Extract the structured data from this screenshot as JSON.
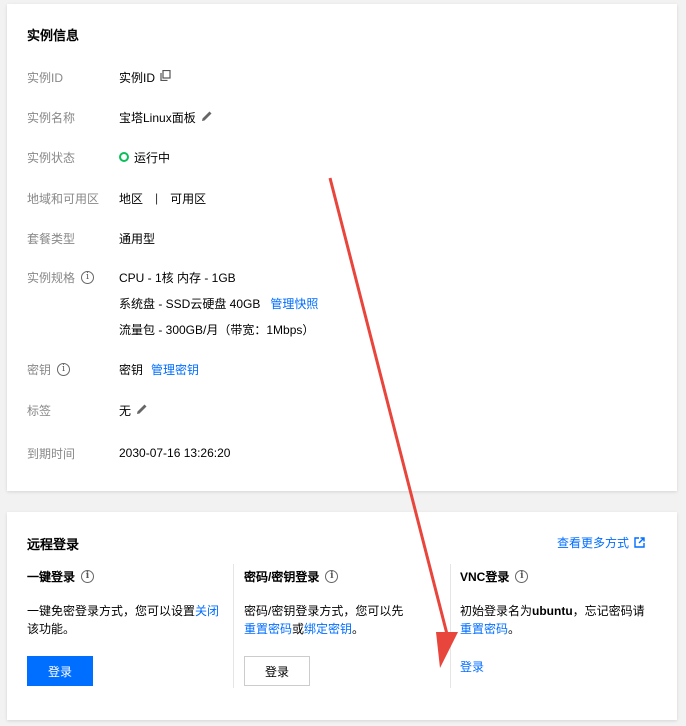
{
  "instance_info": {
    "title": "实例信息",
    "rows": {
      "id": {
        "label": "实例ID",
        "value": "实例ID"
      },
      "name": {
        "label": "实例名称",
        "value": "宝塔Linux面板"
      },
      "status": {
        "label": "实例状态",
        "value": "运行中"
      },
      "region": {
        "label": "地域和可用区",
        "region": "地区",
        "separator": "|",
        "zone": "可用区"
      },
      "plan": {
        "label": "套餐类型",
        "value": "通用型"
      },
      "spec": {
        "label": "实例规格",
        "line1": "CPU - 1核 内存 - 1GB",
        "line2": "系统盘 - SSD云硬盘 40GB",
        "line2_link": "管理快照",
        "line3": "流量包 - 300GB/月（带宽：1Mbps）"
      },
      "key": {
        "label": "密钥",
        "value": "密钥",
        "link": "管理密钥"
      },
      "tags": {
        "label": "标签",
        "value": "无"
      },
      "expiry": {
        "label": "到期时间",
        "value": "2030-07-16 13:26:20"
      }
    }
  },
  "remote_login": {
    "title": "远程登录",
    "more_link": "查看更多方式",
    "one_click": {
      "title": "一键登录",
      "desc_prefix": "一键免密登录方式，您可以设置",
      "desc_link": "关闭",
      "desc_suffix": "该功能。",
      "button": "登录"
    },
    "password": {
      "title": "密码/密钥登录",
      "desc_prefix": "密码/密钥登录方式，您可以先",
      "link1": "重置密码",
      "mid": "或",
      "link2": "绑定密钥",
      "suffix": "。",
      "button": "登录"
    },
    "vnc": {
      "title": "VNC登录",
      "desc_prefix": "初始登录名为",
      "username": "ubuntu",
      "desc_mid": "，忘记密码请",
      "link": "重置密码",
      "suffix": "。",
      "button": "登录"
    }
  },
  "colors": {
    "accent": "#006eff",
    "status_green": "#0abf5b",
    "annotation_arrow": "#e8453c"
  }
}
